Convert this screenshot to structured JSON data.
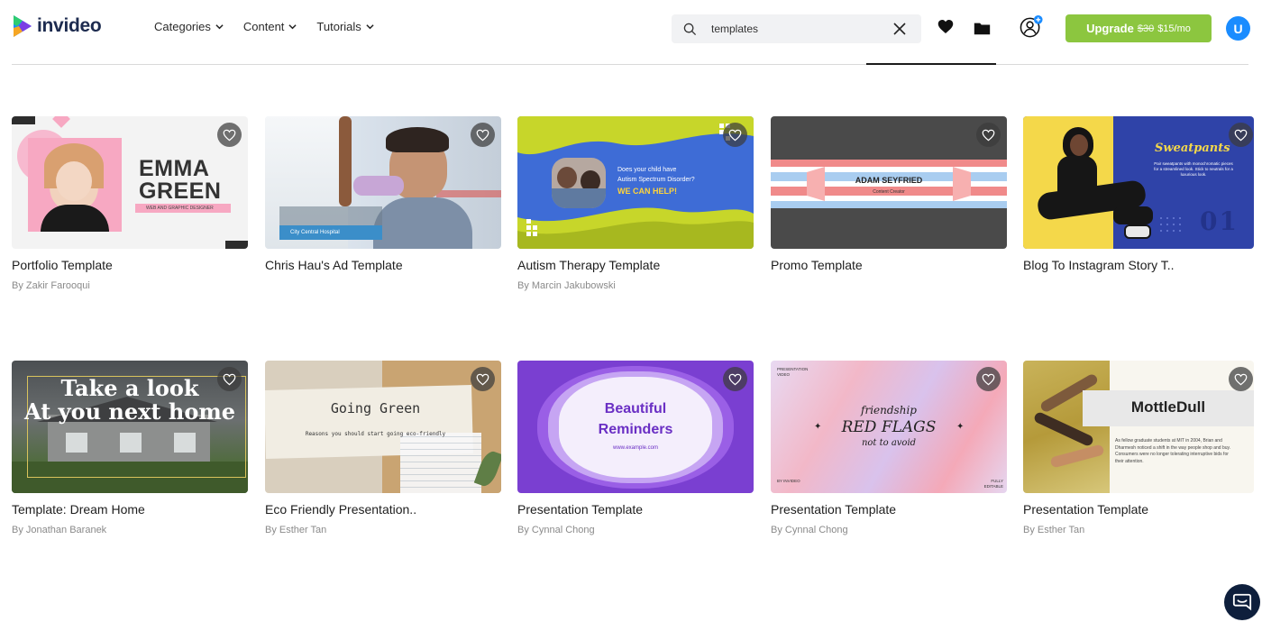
{
  "brand": {
    "name": "invideo"
  },
  "nav": [
    {
      "label": "Categories"
    },
    {
      "label": "Content"
    },
    {
      "label": "Tutorials"
    }
  ],
  "search": {
    "value": "templates",
    "placeholder": ""
  },
  "upgrade": {
    "label": "Upgrade",
    "old_price": "$30",
    "new_price": "$15/mo"
  },
  "user": {
    "initial": "U"
  },
  "colors": {
    "accent": "#8cc63f",
    "avatar": "#1a8cff",
    "navy": "#1d2b4f"
  },
  "cards": [
    {
      "title": "Portfolio Template",
      "author": "By Zakir Farooqui",
      "thumb": {
        "name_line1": "EMMA",
        "name_line2": "GREEN",
        "tag": "WEB AND GRAPHIC DESIGNER"
      }
    },
    {
      "title": "Chris Hau's Ad Template",
      "author": "",
      "thumb": {
        "caption": "City Central Hospital"
      }
    },
    {
      "title": "Autism Therapy Template",
      "author": "By Marcin Jakubowski",
      "thumb": {
        "line1": "Does your child have",
        "line2": "Autism Spectrum Disorder?",
        "cta": "WE CAN HELP!"
      }
    },
    {
      "title": "Promo Template",
      "author": "",
      "thumb": {
        "name": "ADAM SEYFRIED",
        "role": "Content Creator"
      }
    },
    {
      "title": "Blog To Instagram Story T..",
      "author": "",
      "thumb": {
        "heading": "Sweatpants",
        "body": "Pair sweatpants with monochromatic pieces for a streamlined look. Stick to neutrals for a luxurious look.",
        "number": "01"
      }
    },
    {
      "title": "Template: Dream Home",
      "author": "By Jonathan Baranek",
      "thumb": {
        "line1": "Take a look",
        "line2": "At you next home"
      }
    },
    {
      "title": "Eco Friendly Presentation..",
      "author": "By Esther Tan",
      "thumb": {
        "heading": "Going Green",
        "sub": "Reasons you should start going eco-friendly"
      }
    },
    {
      "title": "Presentation Template",
      "author": "By Cynnal Chong",
      "thumb": {
        "line1": "Beautiful",
        "line2": "Reminders",
        "url": "www.example.com"
      }
    },
    {
      "title": "Presentation Template",
      "author": "By Cynnal Chong",
      "thumb": {
        "top_left": "PRESENTATION VIDEO",
        "line1": "friendship",
        "line2": "RED FLAGS",
        "line3": "not to avoid",
        "bottom_left": "BY INVIDEO",
        "bottom_right": "FULLY EDITABLE"
      }
    },
    {
      "title": "Presentation Template",
      "author": "By Esther Tan",
      "thumb": {
        "heading": "MottleDull",
        "body": "As fellow graduate students at MIT in 2004, Brian and Dharmesh noticed a shift in the way people shop and buy. Consumers were no longer tolerating interruptive bids for their attention."
      }
    }
  ]
}
